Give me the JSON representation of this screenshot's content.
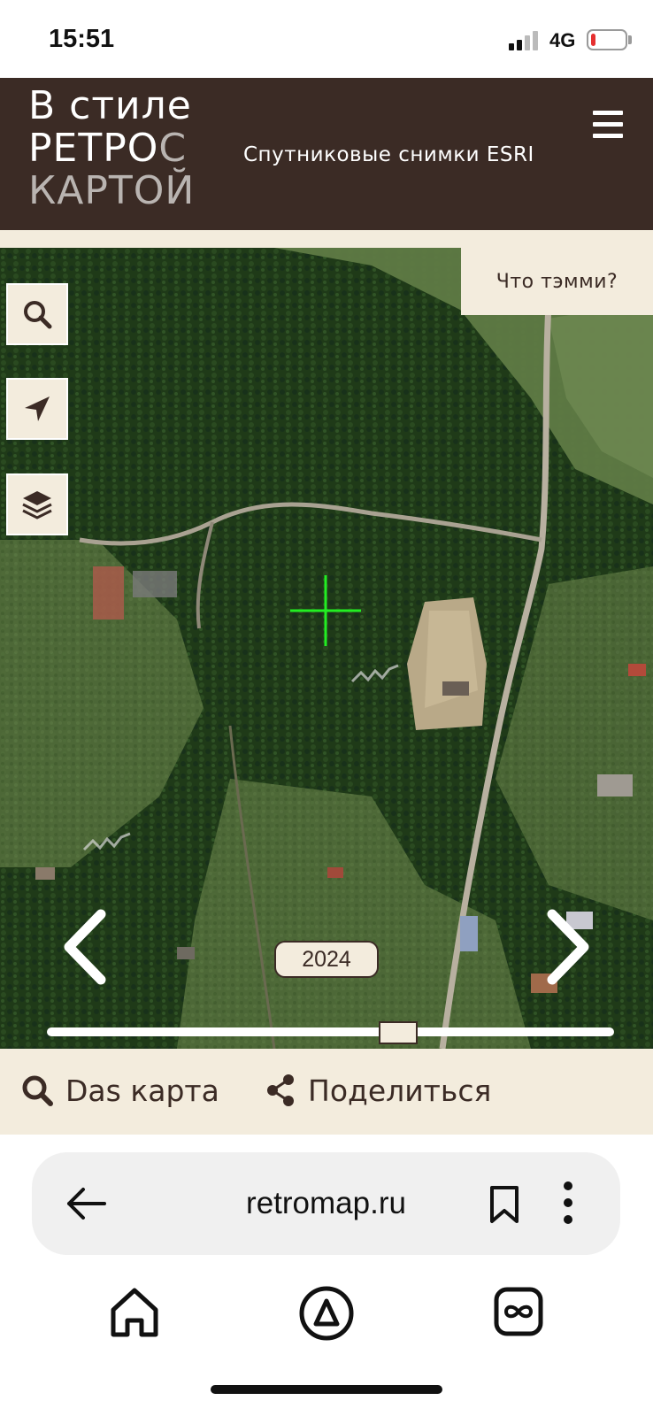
{
  "status_bar": {
    "time": "15:51",
    "network": "4G",
    "battery_level": 0.15,
    "battery_color": "#e53030"
  },
  "header": {
    "logo_line1": "В стиле",
    "logo_line2_main": "РЕТРО",
    "logo_line2_grey": "С",
    "logo_line3": "КАРТОЙ",
    "subtitle": "Спутниковые снимки ESRI",
    "menu_icon": "hamburger-menu-icon",
    "background": "#3b2b25"
  },
  "map": {
    "whats_here_label": "Что тэмми?",
    "search_icon": "search-icon",
    "locate_icon": "location-arrow-icon",
    "layers_icon": "layers-icon",
    "crosshair_color": "#22ee22",
    "year": "2024",
    "timeline_position": 0.62,
    "prev_icon": "chevron-left-icon",
    "next_icon": "chevron-right-icon"
  },
  "actions": {
    "map_label": "Das карта",
    "share_label": "Поделиться",
    "map_icon": "search-icon",
    "share_icon": "share-icon"
  },
  "browser": {
    "url": "retromap.ru",
    "back_icon": "back-arrow-icon",
    "bookmark_icon": "bookmark-icon",
    "more_icon": "more-vertical-icon",
    "nav_icons": [
      "home-icon",
      "alice-assistant-icon",
      "tabs-icon"
    ]
  }
}
